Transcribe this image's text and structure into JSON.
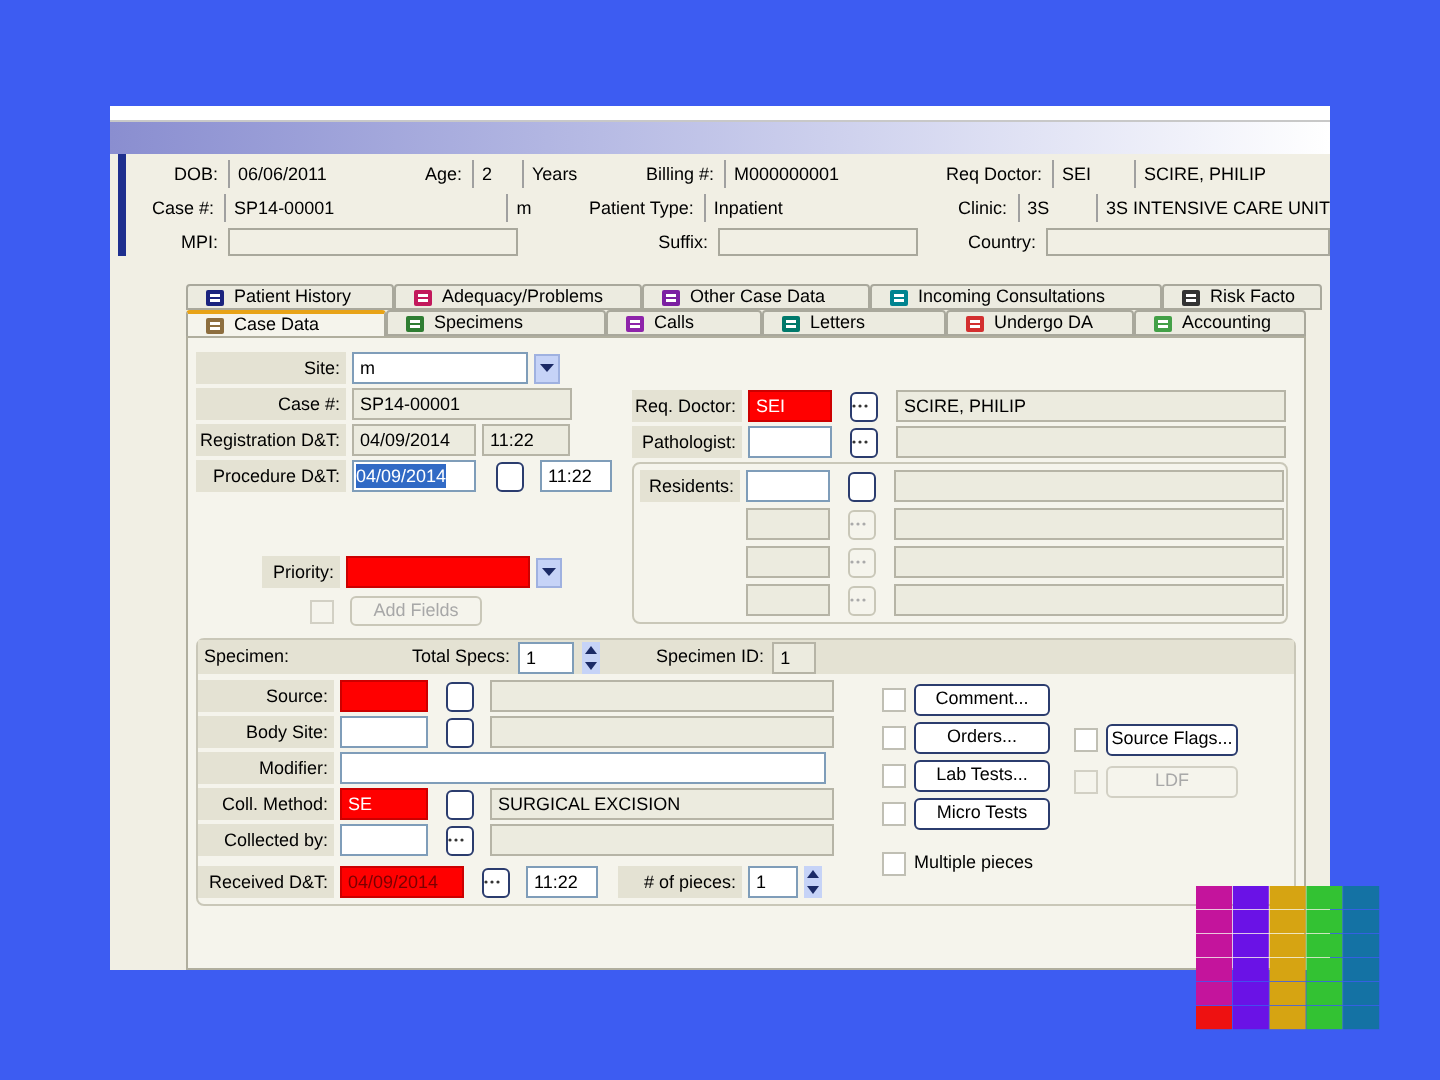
{
  "header": {
    "dob": {
      "label": "DOB:",
      "value": "06/06/2011"
    },
    "age": {
      "label": "Age:",
      "value": "2",
      "unit": "Years"
    },
    "billing": {
      "label": "Billing #:",
      "value": "M000000001"
    },
    "req_doctor": {
      "label": "Req Doctor:",
      "code": "SEI",
      "name": "SCIRE, PHILIP"
    },
    "case": {
      "label": "Case #:",
      "value": "SP14-00001",
      "unit": "m"
    },
    "patient_type": {
      "label": "Patient Type:",
      "value": "Inpatient"
    },
    "clinic": {
      "label": "Clinic:",
      "code": "3S",
      "name": "3S INTENSIVE CARE UNIT"
    },
    "mpi": {
      "label": "MPI:"
    },
    "suffix": {
      "label": "Suffix:"
    },
    "country": {
      "label": "Country:"
    }
  },
  "tabs": [
    [
      {
        "label": "Patient History",
        "selected": false
      },
      {
        "label": "Adequacy/Problems",
        "selected": false
      },
      {
        "label": "Other Case Data",
        "selected": false
      },
      {
        "label": "Incoming Consultations",
        "selected": false
      },
      {
        "label": "Risk Facto",
        "selected": false
      }
    ],
    [
      {
        "label": "Case Data",
        "selected": true
      },
      {
        "label": "Specimens",
        "selected": false
      },
      {
        "label": "Calls",
        "selected": false
      },
      {
        "label": "Letters",
        "selected": false
      },
      {
        "label": "Undergo DA",
        "selected": false
      },
      {
        "label": "Accounting",
        "selected": false
      }
    ]
  ],
  "case_form": {
    "fields": [
      {
        "kind": "dropdown",
        "label": "Site:",
        "value": "m"
      },
      {
        "kind": "readonly",
        "label": "Case #:",
        "value": "SP14-00001"
      },
      {
        "kind": "datetime",
        "label": "Registration D&T:",
        "date": "04/09/2014",
        "time": "11:22"
      },
      {
        "kind": "datetime_check",
        "label": "Procedure D&T:",
        "date": "04/09/2014",
        "time": "11:22",
        "date_selected": true
      }
    ],
    "priority": {
      "label": "Priority:",
      "required": true
    },
    "add_fields": {
      "label": "Add Fields",
      "disabled": true,
      "checked": false
    },
    "staff": [
      {
        "label": "Req. Doctor:",
        "code": "SEI",
        "name": "SCIRE, PHILIP",
        "required": true
      },
      {
        "label": "Pathologist:",
        "required": false
      }
    ],
    "residents": [
      {
        "label": "Residents:",
        "disabled": false
      },
      {
        "disabled": true
      },
      {
        "disabled": true
      },
      {
        "disabled": true
      }
    ]
  },
  "specimen": {
    "title": "Specimen:",
    "total_label": "Total Specs:",
    "total": "1",
    "id_label": "Specimen ID:",
    "id": "1",
    "fields": [
      {
        "kind": "lookup",
        "label": "Source:",
        "required": true
      },
      {
        "kind": "lookup",
        "label": "Body Site:",
        "required": false
      },
      {
        "kind": "text",
        "label": "Modifier:"
      },
      {
        "kind": "lookup",
        "label": "Coll. Method:",
        "code": "SE",
        "name": "SURGICAL EXCISION",
        "required": true
      },
      {
        "kind": "picker",
        "label": "Collected by:",
        "required": false
      }
    ],
    "received": {
      "label": "Received D&T:",
      "date": "04/09/2014",
      "time": "11:22",
      "required": true,
      "pieces_label": "# of pieces:",
      "pieces": "1"
    },
    "buttons": [
      {
        "label": "Comment...",
        "checked": false
      },
      {
        "label": "Orders...",
        "checked": false
      },
      {
        "label": "Lab Tests...",
        "checked": false
      },
      {
        "label": "Micro Tests",
        "checked": false
      }
    ],
    "side_buttons": [
      {
        "label": "Source Flags...",
        "checked": false,
        "disabled": false
      },
      {
        "label": "LDF",
        "checked": false,
        "disabled": true
      }
    ],
    "multiple": {
      "label": "Multiple pieces",
      "checked": false
    }
  }
}
